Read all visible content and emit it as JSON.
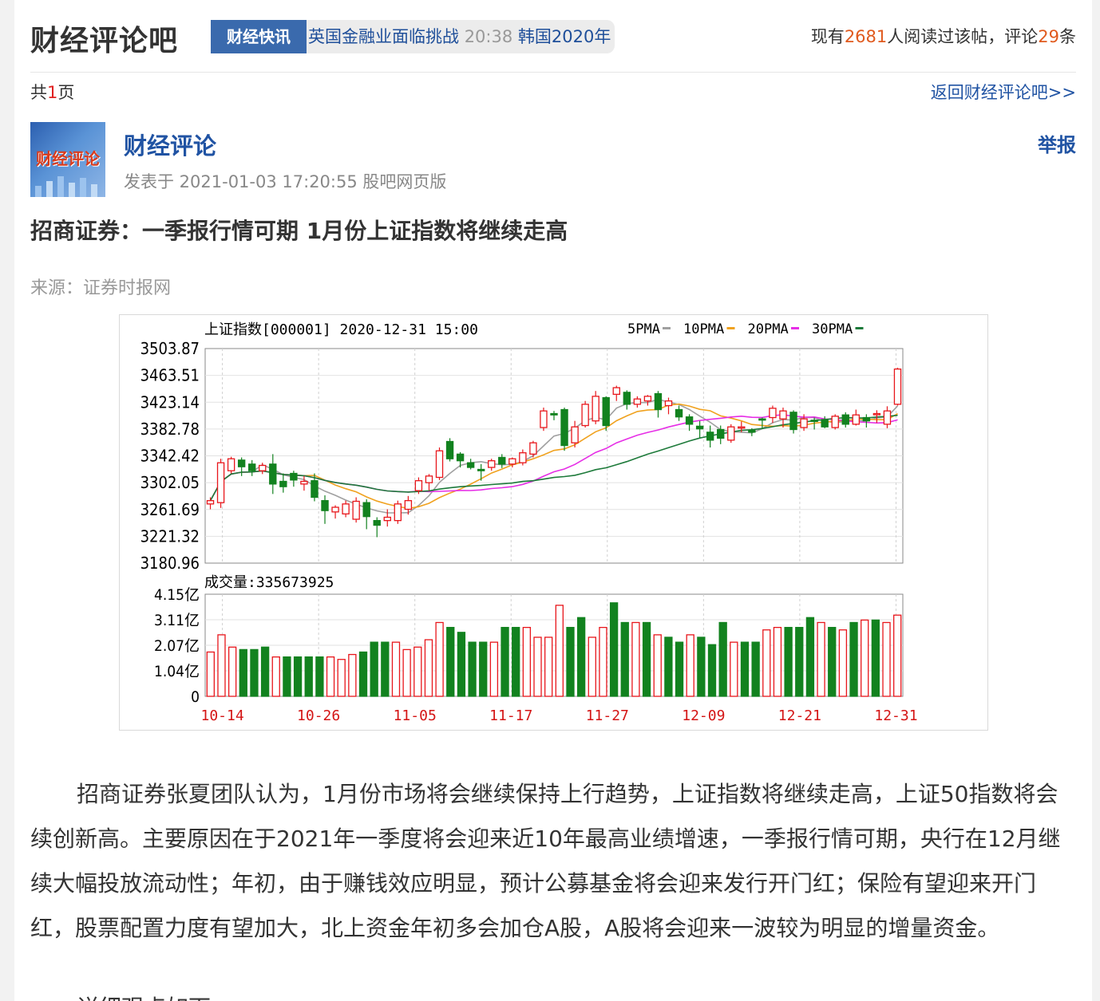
{
  "header": {
    "site_title": "财经评论吧",
    "ticker_badge": "财经快讯",
    "ticker_item1": "英国金融业面临挑战",
    "ticker_time": "20:38",
    "ticker_item2": "韩国2020年",
    "read_prefix": "现有",
    "read_count": "2681",
    "read_mid": "人阅读过该帖，评论",
    "comment_count": "29",
    "read_suffix": "条"
  },
  "pager": {
    "prefix": "共",
    "count": "1",
    "suffix": "页",
    "back_link": "返回财经评论吧>>"
  },
  "post": {
    "avatar_text": "财经评论",
    "author": "财经评论",
    "report": "举报",
    "meta": "发表于 2021-01-03 17:20:55 股吧网页版",
    "title": "招商证券：一季报行情可期 1月份上证指数将继续走高",
    "source": "来源：证券时报网",
    "paragraph1": "招商证券张夏团队认为，1月份市场将会继续保持上行趋势，上证指数将继续走高，上证50指数将会续创新高。主要原因在于2021年一季度将会迎来近10年最高业绩增速，一季报行情可期，央行在12月继续大幅投放流动性；年初，由于赚钱效应明显，预计公募基金将会迎来发行开门红；保险有望迎来开门红，股票配置力度有望加大，北上资金年初多会加仓A股，A股将会迎来一波较为明显的增量资金。",
    "paragraph2": "详细观点如下："
  },
  "colors": {
    "up": "#e8161b",
    "down": "#12821f",
    "ma5": "#a0a0a0",
    "ma10": "#f0a21f",
    "ma20": "#e62ee6",
    "ma30": "#1d7a3a",
    "link": "#2053a3"
  },
  "chart_data": {
    "type": "candlestick",
    "title": "上证指数[000001] 2020-12-31 15:00",
    "legend": [
      "5PMA",
      "10PMA",
      "20PMA",
      "30PMA"
    ],
    "price_ticks": [
      "3503.87",
      "3463.51",
      "3423.14",
      "3382.78",
      "3342.42",
      "3302.05",
      "3261.69",
      "3221.32",
      "3180.96"
    ],
    "price_range": [
      3180.96,
      3503.87
    ],
    "volume_label": "成交量:335673925",
    "volume_ticks": [
      "4.15亿",
      "3.11亿",
      "2.07亿",
      "1.04亿",
      "0"
    ],
    "volume_max": 4.15,
    "x_labels": [
      "10-14",
      "10-26",
      "11-05",
      "11-17",
      "11-27",
      "12-09",
      "12-21",
      "12-31"
    ],
    "x_label_index": [
      1,
      9,
      17,
      25,
      33,
      41,
      49,
      57
    ],
    "candles": [
      [
        3270,
        3275,
        3262,
        3280
      ],
      [
        3272,
        3332,
        3264,
        3338
      ],
      [
        3320,
        3338,
        3316,
        3341
      ],
      [
        3336,
        3326,
        3312,
        3340
      ],
      [
        3330,
        3320,
        3312,
        3336
      ],
      [
        3320,
        3328,
        3315,
        3332
      ],
      [
        3330,
        3300,
        3285,
        3345
      ],
      [
        3304,
        3296,
        3287,
        3316
      ],
      [
        3316,
        3306,
        3296,
        3320
      ],
      [
        3300,
        3304,
        3290,
        3312
      ],
      [
        3305,
        3280,
        3274,
        3316
      ],
      [
        3275,
        3260,
        3240,
        3283
      ],
      [
        3258,
        3265,
        3248,
        3268
      ],
      [
        3255,
        3270,
        3250,
        3275
      ],
      [
        3247,
        3274,
        3242,
        3280
      ],
      [
        3272,
        3251,
        3232,
        3277
      ],
      [
        3245,
        3238,
        3220,
        3250
      ],
      [
        3245,
        3250,
        3236,
        3262
      ],
      [
        3245,
        3270,
        3240,
        3275
      ],
      [
        3262,
        3275,
        3254,
        3282
      ],
      [
        3290,
        3305,
        3285,
        3310
      ],
      [
        3302,
        3312,
        3290,
        3315
      ],
      [
        3310,
        3350,
        3306,
        3355
      ],
      [
        3364,
        3338,
        3334,
        3369
      ],
      [
        3345,
        3335,
        3325,
        3348
      ],
      [
        3332,
        3325,
        3322,
        3338
      ],
      [
        3322,
        3320,
        3305,
        3330
      ],
      [
        3325,
        3335,
        3320,
        3338
      ],
      [
        3340,
        3330,
        3324,
        3345
      ],
      [
        3330,
        3338,
        3325,
        3340
      ],
      [
        3332,
        3347,
        3328,
        3352
      ],
      [
        3345,
        3362,
        3340,
        3365
      ],
      [
        3385,
        3410,
        3380,
        3415
      ],
      [
        3406,
        3404,
        3396,
        3410
      ],
      [
        3412,
        3358,
        3350,
        3415
      ],
      [
        3362,
        3386,
        3355,
        3395
      ],
      [
        3388,
        3420,
        3385,
        3425
      ],
      [
        3395,
        3432,
        3390,
        3440
      ],
      [
        3430,
        3388,
        3380,
        3432
      ],
      [
        3435,
        3445,
        3425,
        3448
      ],
      [
        3438,
        3420,
        3412,
        3441
      ],
      [
        3420,
        3428,
        3415,
        3432
      ],
      [
        3425,
        3432,
        3418,
        3434
      ],
      [
        3436,
        3412,
        3400,
        3440
      ],
      [
        3418,
        3425,
        3405,
        3430
      ],
      [
        3412,
        3401,
        3395,
        3418
      ],
      [
        3401,
        3390,
        3380,
        3405
      ],
      [
        3387,
        3383,
        3370,
        3395
      ],
      [
        3378,
        3366,
        3355,
        3388
      ],
      [
        3382,
        3369,
        3360,
        3388
      ],
      [
        3366,
        3386,
        3362,
        3390
      ],
      [
        3386,
        3386,
        3378,
        3394
      ],
      [
        3381,
        3378,
        3372,
        3384
      ],
      [
        3398,
        3397,
        3383,
        3400
      ],
      [
        3400,
        3414,
        3392,
        3418
      ],
      [
        3398,
        3410,
        3385,
        3415
      ],
      [
        3408,
        3382,
        3376,
        3411
      ],
      [
        3385,
        3398,
        3380,
        3405
      ],
      [
        3396,
        3395,
        3382,
        3400
      ],
      [
        3397,
        3386,
        3384,
        3402
      ],
      [
        3385,
        3402,
        3382,
        3405
      ],
      [
        3404,
        3390,
        3385,
        3408
      ],
      [
        3390,
        3404,
        3388,
        3412
      ],
      [
        3400,
        3395,
        3385,
        3405
      ],
      [
        3405,
        3406,
        3392,
        3411
      ],
      [
        3390,
        3410,
        3384,
        3417
      ],
      [
        3420,
        3473,
        3418,
        3475
      ]
    ],
    "volumes": [
      1.8,
      2.5,
      2.0,
      1.9,
      1.9,
      2.0,
      1.6,
      1.6,
      1.6,
      1.6,
      1.6,
      1.6,
      1.5,
      1.7,
      1.8,
      2.2,
      2.2,
      2.2,
      1.9,
      2.0,
      2.3,
      3.0,
      2.8,
      2.6,
      2.2,
      2.2,
      2.2,
      2.8,
      2.8,
      2.8,
      2.4,
      2.4,
      3.7,
      2.8,
      3.2,
      2.4,
      2.8,
      3.8,
      3.0,
      3.0,
      3.0,
      2.5,
      2.4,
      2.2,
      2.5,
      2.4,
      2.1,
      3.0,
      2.2,
      2.2,
      2.2,
      2.7,
      2.8,
      2.8,
      2.8,
      3.2,
      3.0,
      2.8,
      2.7,
      3.0,
      3.1,
      3.1,
      3.0,
      3.3
    ],
    "volume_up": [
      true,
      true,
      true,
      false,
      false,
      false,
      true,
      false,
      false,
      false,
      false,
      true,
      true,
      true,
      false,
      false,
      false,
      true,
      true,
      true,
      true,
      true,
      false,
      false,
      false,
      false,
      true,
      false,
      false,
      true,
      true,
      true,
      true,
      false,
      false,
      true,
      true,
      false,
      false,
      true,
      false,
      true,
      false,
      false,
      true,
      false,
      false,
      false,
      true,
      false,
      false,
      true,
      true,
      false,
      false,
      false,
      true,
      false,
      true,
      false,
      true,
      false,
      true,
      true
    ]
  }
}
